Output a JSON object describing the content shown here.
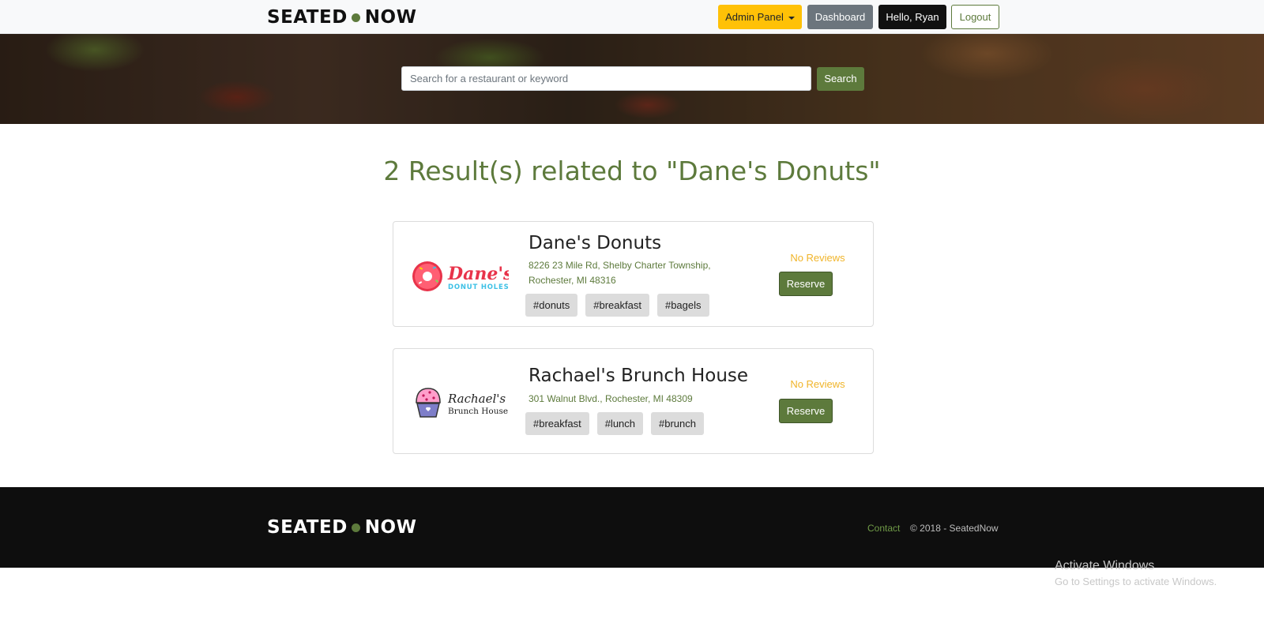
{
  "navbar": {
    "brand_left": "SEATED",
    "brand_right": "NOW",
    "admin_label": "Admin Panel",
    "dashboard_label": "Dashboard",
    "hello_label": "Hello, Ryan",
    "logout_label": "Logout"
  },
  "search": {
    "placeholder": "Search for a restaurant or keyword",
    "value": "",
    "button_label": "Search"
  },
  "results": {
    "heading": "2 Result(s) related to \"Dane's Donuts\"",
    "items": [
      {
        "name": "Dane's Donuts",
        "address_line1": "8226 23 Mile Rd, Shelby Charter Township,",
        "address_line2": "Rochester, MI 48316",
        "tags": [
          "#donuts",
          "#breakfast",
          "#bagels"
        ],
        "reviews": "No Reviews",
        "reserve_label": "Reserve",
        "logo": {
          "text_main": "Dane's",
          "text_sub": "DONUT HOLES"
        }
      },
      {
        "name": "Rachael's Brunch House",
        "address_line1": "301 Walnut Blvd., Rochester, MI 48309",
        "address_line2": "",
        "tags": [
          "#breakfast",
          "#lunch",
          "#brunch"
        ],
        "reviews": "No Reviews",
        "reserve_label": "Reserve",
        "logo": {
          "text_main": "Rachael's",
          "text_sub": "Brunch House"
        }
      }
    ]
  },
  "footer": {
    "brand_left": "SEATED",
    "brand_right": "NOW",
    "contact_label": "Contact",
    "copyright": "© 2018 - SeatedNow"
  },
  "watermark": {
    "title": "Activate Windows",
    "subtitle": "Go to Settings to activate Windows."
  },
  "colors": {
    "brand_green": "#5d7a3c",
    "admin_yellow": "#ffc107",
    "review_gold": "#f0b429",
    "footer_bg": "#0e0e0e"
  }
}
